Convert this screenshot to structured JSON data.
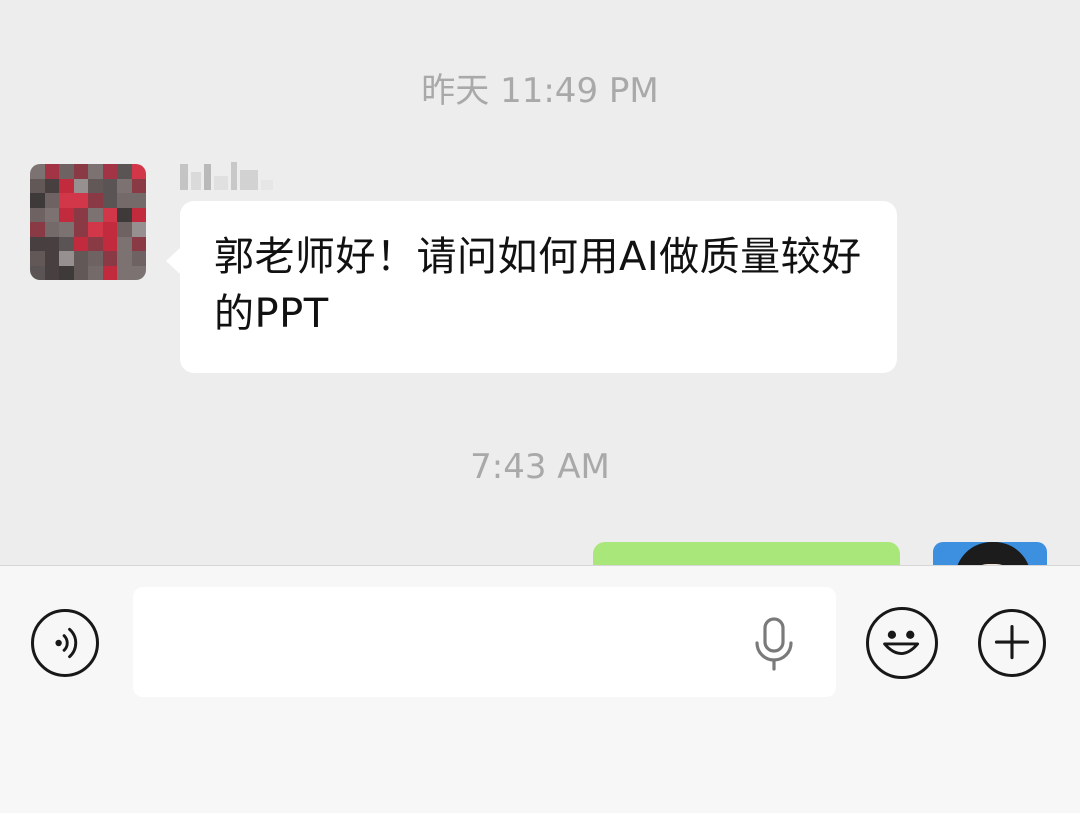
{
  "chat": {
    "timestamps": [
      "昨天 11:49 PM",
      "7:43 AM"
    ],
    "messages": [
      {
        "side": "left",
        "text": "郭老师好！请问如何用AI做质量较好的PPT"
      }
    ]
  },
  "input": {
    "placeholder": ""
  },
  "icons": {
    "voice": "voice-mode-icon",
    "mic": "microphone-icon",
    "emoji": "emoji-icon",
    "plus": "plus-icon"
  },
  "colors": {
    "background": "#ededed",
    "bubble_incoming": "#ffffff",
    "bubble_outgoing": "#a9e77a",
    "timestamp": "#a9a9a9",
    "input_bar": "#f7f7f7"
  }
}
